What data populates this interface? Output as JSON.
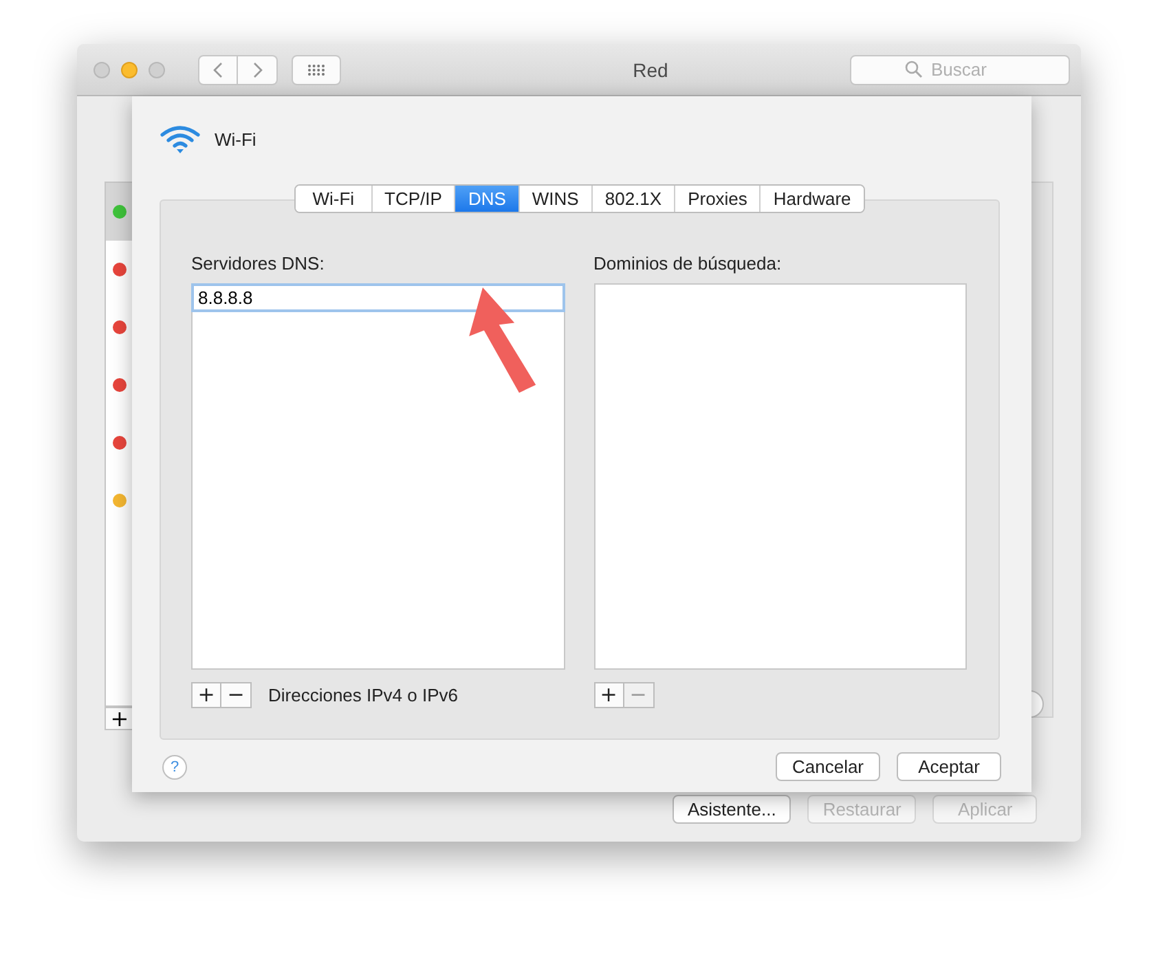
{
  "window": {
    "title": "Red",
    "search": {
      "placeholder": "Buscar"
    }
  },
  "services": [
    {
      "color": "#3fc33b",
      "selected": true
    },
    {
      "color": "#e8453c",
      "selected": false
    },
    {
      "color": "#e8453c",
      "selected": false
    },
    {
      "color": "#e8453c",
      "selected": false
    },
    {
      "color": "#e8453c",
      "selected": false
    },
    {
      "color": "#f5b731",
      "selected": false
    }
  ],
  "services_add": "+",
  "buttons": [
    {
      "label": "Asistente...",
      "disabled": false
    },
    {
      "label": "Restaurar",
      "disabled": true
    },
    {
      "label": "Aplicar",
      "disabled": true
    }
  ],
  "sheet": {
    "title": "Wi-Fi",
    "tabs": [
      {
        "label": "Wi-Fi",
        "selected": false
      },
      {
        "label": "TCP/IP",
        "selected": false
      },
      {
        "label": "DNS",
        "selected": true
      },
      {
        "label": "WINS",
        "selected": false
      },
      {
        "label": "802.1X",
        "selected": false
      },
      {
        "label": "Proxies",
        "selected": false
      },
      {
        "label": "Hardware",
        "selected": false
      }
    ],
    "dns_servers": {
      "label": "Servidores DNS:",
      "entries": [
        {
          "value": "8.8.8.8",
          "editing": true
        }
      ],
      "add": "+",
      "remove": "−",
      "remove_disabled": false,
      "hint": "Direcciones IPv4 o IPv6"
    },
    "search_domains": {
      "label": "Dominios de búsqueda:",
      "add": "+",
      "remove": "−",
      "remove_disabled": true
    },
    "help": "?",
    "buttons": [
      {
        "label": "Cancelar"
      },
      {
        "label": "Aceptar"
      }
    ]
  }
}
